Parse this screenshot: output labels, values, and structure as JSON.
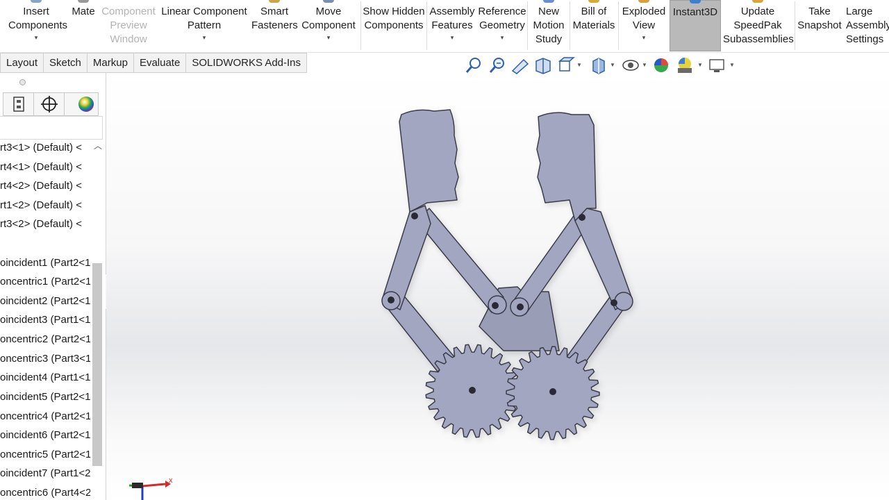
{
  "ribbon": {
    "buttons": [
      {
        "label": "Insert Components",
        "state": "normal",
        "has_dropdown": true
      },
      {
        "label": "Mate",
        "state": "normal",
        "has_dropdown": false
      },
      {
        "label": "Component Preview Window",
        "state": "disabled",
        "has_dropdown": false
      },
      {
        "label": "Linear Component Pattern",
        "state": "normal",
        "has_dropdown": true
      },
      {
        "label": "Smart Fasteners",
        "state": "normal",
        "has_dropdown": false
      },
      {
        "label": "Move Component",
        "state": "normal",
        "has_dropdown": true
      },
      {
        "label": "Show Hidden Components",
        "state": "normal",
        "has_dropdown": false
      },
      {
        "label": "Assembly Features",
        "state": "normal",
        "has_dropdown": true
      },
      {
        "label": "Reference Geometry",
        "state": "normal",
        "has_dropdown": true
      },
      {
        "label": "New Motion Study",
        "state": "normal",
        "has_dropdown": false
      },
      {
        "label": "Bill of Materials",
        "state": "normal",
        "has_dropdown": false
      },
      {
        "label": "Exploded View",
        "state": "normal",
        "has_dropdown": true
      },
      {
        "label": "Instant3D",
        "state": "active",
        "has_dropdown": false
      },
      {
        "label": "Update SpeedPak Subassemblies",
        "state": "normal",
        "has_dropdown": false
      },
      {
        "label": "Take Snapshot",
        "state": "normal",
        "has_dropdown": false
      },
      {
        "label": "Large Assembly Settings",
        "state": "normal",
        "has_dropdown": false
      }
    ],
    "dropdown_glyph": "▾"
  },
  "command_tabs": [
    "Layout",
    "Sketch",
    "Markup",
    "Evaluate",
    "SOLIDWORKS Add-Ins"
  ],
  "view_toolbar": {
    "icons": [
      "zoom-to-fit-icon",
      "zoom-to-area-icon",
      "previous-view-icon",
      "section-view-icon",
      "view-orientation-icon",
      "display-style-icon",
      "hide-show-items-icon",
      "edit-appearance-icon",
      "apply-scene-icon",
      "view-settings-icon"
    ]
  },
  "feature_manager": {
    "tab_icons": [
      "configuration-manager-icon",
      "dimxpert-manager-icon",
      "display-manager-icon"
    ],
    "items": [
      "rt3<1> (Default) <",
      "rt4<1> (Default) <",
      "rt4<2> (Default) <",
      "rt1<2> (Default) <",
      "rt3<2> (Default) <",
      "",
      "oincident1 (Part2<1",
      "oncentric1 (Part2<1",
      "oincident2 (Part2<1",
      "oincident3 (Part1<1",
      "oncentric2 (Part2<1",
      "oncentric3 (Part3<1",
      "oincident4 (Part1<1",
      "oincident5 (Part2<1",
      "oncentric4 (Part2<1",
      "oincident6 (Part2<1",
      "oncentric5 (Part2<1",
      "oincident7 (Part1<2",
      "oncentric6 (Part4<2"
    ]
  },
  "viewport": {
    "model_name": "robotic-gripper-assembly",
    "part_color": "#a3a6c0",
    "edge_color": "#3a3b4a",
    "gear_teeth_count": 24,
    "triad_x_label": "x"
  }
}
